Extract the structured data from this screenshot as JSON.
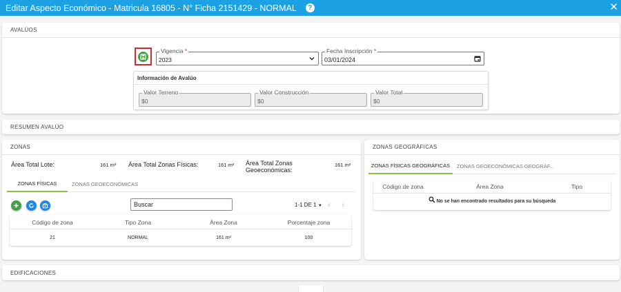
{
  "window": {
    "title": "Editar Aspecto Económico - Matricula 16805 - N° Ficha 2151429 - NORMAL"
  },
  "avaluos": {
    "header": "AVALÚOS",
    "vigencia": {
      "label": "Vigencia",
      "required_mark": "*",
      "value": "2023"
    },
    "fecha_inscripcion": {
      "label": "Fecha Inscripción",
      "required_mark": "*",
      "value": "03/01/2024"
    },
    "info": {
      "title": "Información de Avalúo",
      "valor_terreno": {
        "label": "Valor Terreno",
        "value": "$0"
      },
      "valor_construccion": {
        "label": "Valor Construcción",
        "value": "$0"
      },
      "valor_total": {
        "label": "Valor Total",
        "value": "$0"
      }
    }
  },
  "resumen": {
    "header": "RESUMEN AVALÚO"
  },
  "zonas": {
    "header": "ZONAS",
    "area_total_lote": {
      "label": "Área Total Lote:",
      "value": "161 m²"
    },
    "area_total_fisicas": {
      "label": "Área Total Zonas Físicas:",
      "value": "161 m²"
    },
    "area_total_geo": {
      "label": "Área Total Zonas Geoeconómicas:",
      "value": "161 m²"
    },
    "tabs": [
      "ZONAS FÍSICAS",
      "ZONAS GEOECONÓMICAS"
    ],
    "search_placeholder": "Buscar",
    "pagination": "1-1 DE 1",
    "columns": [
      "Código de zona",
      "Tipo Zona",
      "Área Zona",
      "Porcentaje zona"
    ],
    "rows": [
      {
        "codigo": "21",
        "tipo": "NORMAL",
        "area": "161 m²",
        "porcentaje": "100"
      }
    ]
  },
  "zonas_geo": {
    "header": "ZONAS GEOGRÁFICAS",
    "tabs": [
      "ZONAS FÍSICAS GEOGRÁFICAS",
      "ZONAS GEOECONÓMICAS GEOGRÁF..."
    ],
    "columns": [
      "Código de zona",
      "Área Zona",
      "Tipo"
    ],
    "empty_message": "No se han encontrado resultados para su búsqueda"
  },
  "edificaciones": {
    "header": "EDIFICACIONES"
  },
  "icons": {
    "help": "help-icon",
    "close": "close-icon",
    "save": "save-icon",
    "chevron": "chevron-down-icon",
    "calendar": "calendar-icon",
    "add": "add-icon",
    "refresh": "refresh-icon",
    "export": "export-icon",
    "search": "search-icon",
    "prev": "chevron-left-icon",
    "next": "chevron-right-icon"
  },
  "colors": {
    "title_bar": "#1da1e5",
    "accent_green": "#43a047",
    "action_blue": "#1e88e5",
    "tab_underline": "#8bc34a",
    "highlight": "#d12b2b"
  }
}
